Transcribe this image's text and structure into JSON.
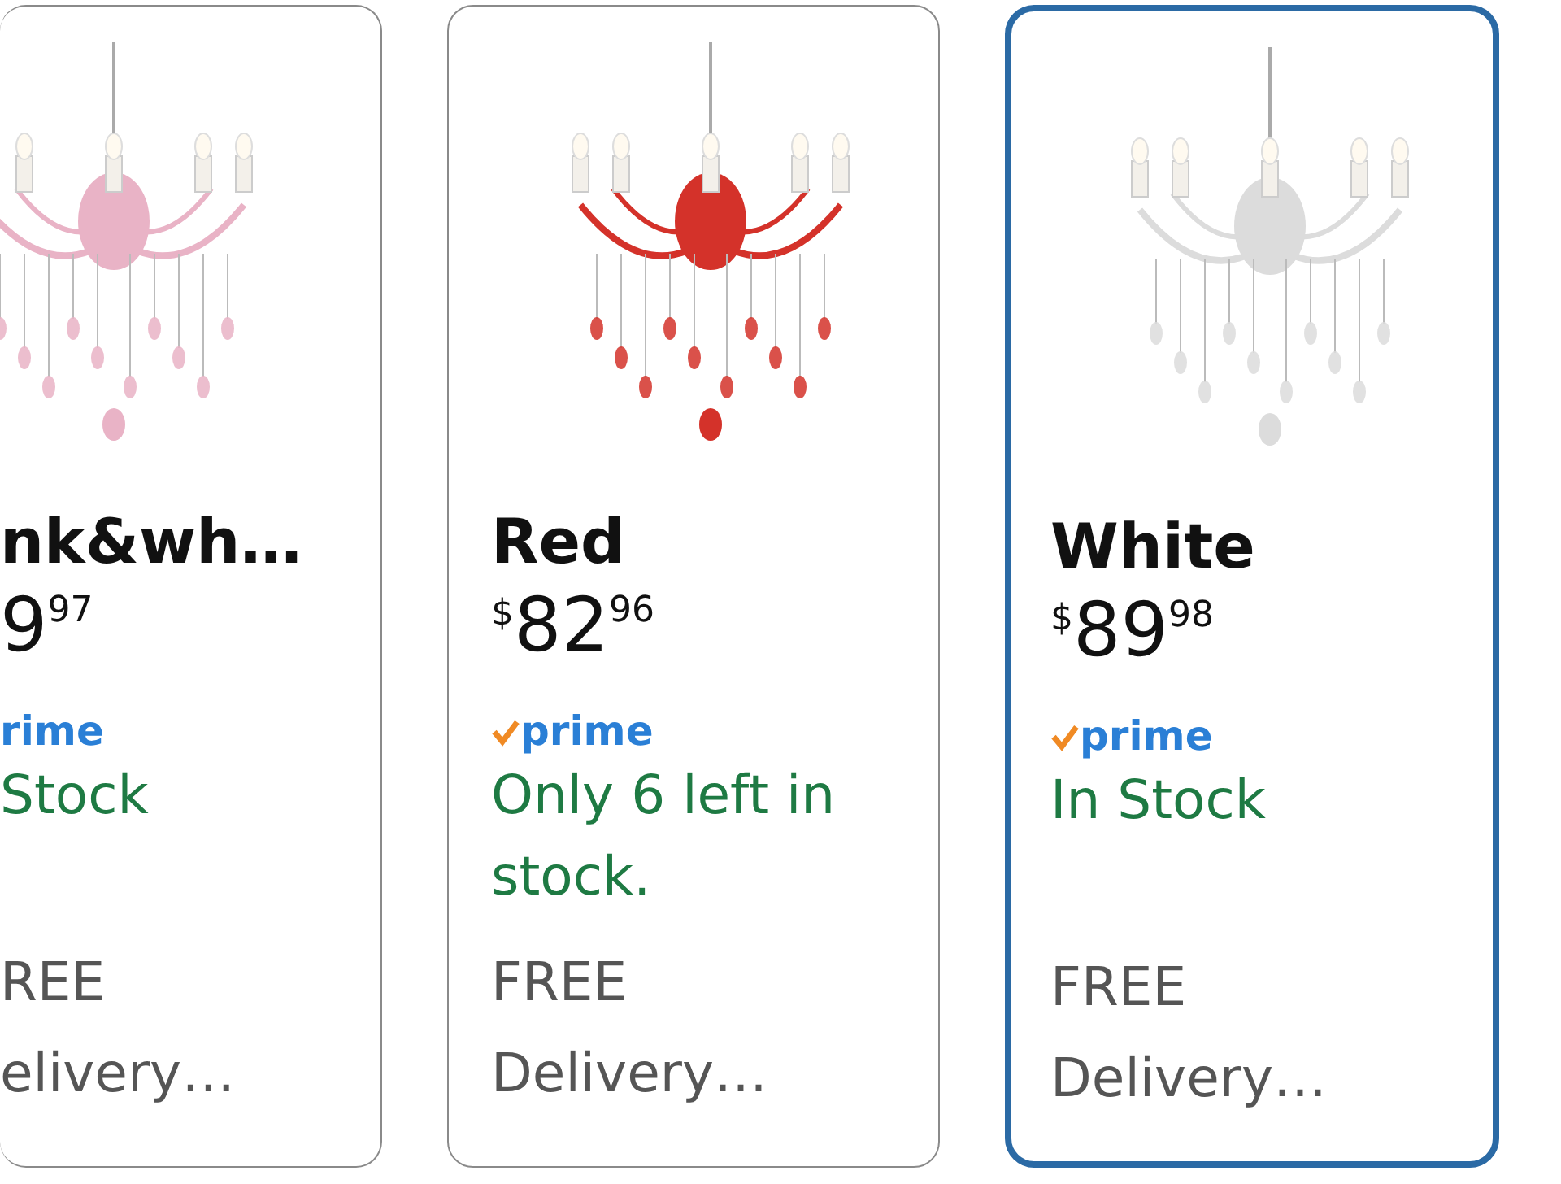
{
  "products": [
    {
      "kind": "clipped",
      "selected": false,
      "color": "#e9b3c6",
      "name": "nk&wh…",
      "price": {
        "whole": "9",
        "fraction": "97"
      },
      "prime": {
        "label": "rime",
        "check": false
      },
      "stock": "Stock",
      "shipping": "REE",
      "delivery": "elivery…"
    },
    {
      "kind": "full",
      "selected": false,
      "color": "#d4322a",
      "name": "Red",
      "price": {
        "currency": "$",
        "whole": "82",
        "fraction": "96"
      },
      "prime": {
        "label": "prime",
        "check": true
      },
      "stock": "Only 6 left in stock.",
      "shipping": "FREE",
      "delivery": "Delivery…"
    },
    {
      "kind": "full",
      "selected": true,
      "color": "#dcdcdc",
      "name": "White",
      "price": {
        "currency": "$",
        "whole": "89",
        "fraction": "98"
      },
      "prime": {
        "label": "prime",
        "check": true
      },
      "stock": "In Stock",
      "shipping": "FREE",
      "delivery": "Delivery…"
    }
  ]
}
